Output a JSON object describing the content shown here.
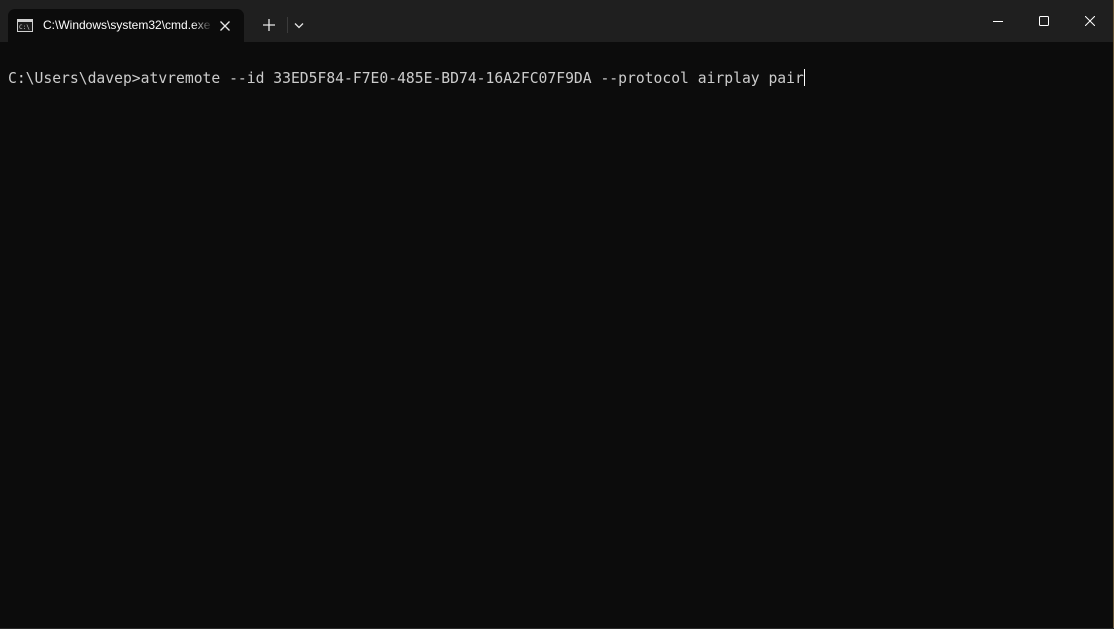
{
  "window": {
    "tab_title": "C:\\Windows\\system32\\cmd.exe",
    "tab_icon": "console-icon",
    "new_tab_icon": "plus-icon",
    "dropdown_icon": "chevron-down-icon",
    "minimize_icon": "minimize-icon",
    "maximize_icon": "maximize-icon",
    "close_icon": "close-icon"
  },
  "terminal": {
    "prompt": "C:\\Users\\davep>",
    "command": "atvremote --id 33ED5F84-F7E0-485E-BD74-16A2FC07F9DA --protocol airplay pair"
  },
  "colors": {
    "titlebar_bg": "#1f1f1f",
    "terminal_bg": "#0c0c0c",
    "terminal_text": "#cccccc"
  }
}
